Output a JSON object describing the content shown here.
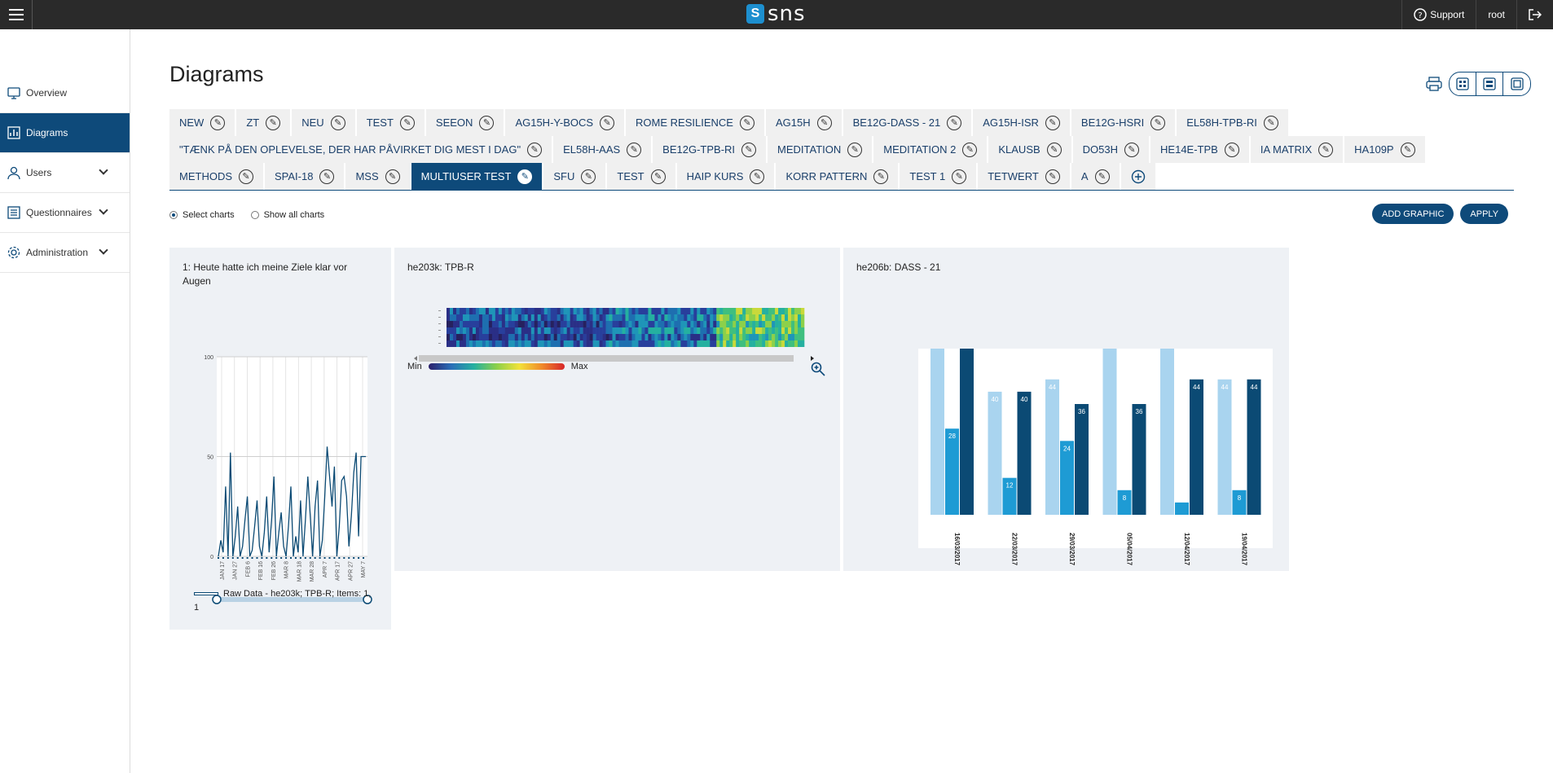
{
  "topbar": {
    "logo_text": "SNS",
    "logo_mark": "S",
    "support_label": "Support",
    "user_label": "root"
  },
  "sidebar": {
    "items": [
      {
        "label": "Overview",
        "icon": "monitor-icon",
        "active": false,
        "expandable": false
      },
      {
        "label": "Diagrams",
        "icon": "chart-icon",
        "active": true,
        "expandable": false
      },
      {
        "label": "Users",
        "icon": "user-icon",
        "active": false,
        "expandable": true
      },
      {
        "label": "Questionnaires",
        "icon": "list-icon",
        "active": false,
        "expandable": true
      },
      {
        "label": "Administration",
        "icon": "gear-icon",
        "active": false,
        "expandable": true
      }
    ]
  },
  "page": {
    "title": "Diagrams"
  },
  "tabs": {
    "row1": [
      "NEW",
      "ZT",
      "NEU",
      "TEST",
      "SEEON",
      "AG15H-Y-BOCS",
      "ROME RESILIENCE",
      "AG15H",
      "BE12G-DASS - 21",
      "AG15H-ISR",
      "BE12G-HSRI",
      "EL58H-TPB-RI"
    ],
    "row2": [
      "\"TÆNK PÅ DEN OPLEVELSE, DER HAR PÅVIRKET DIG MEST I DAG\"",
      "EL58H-AAS",
      "BE12G-TPB-RI",
      "MEDITATION",
      "MEDITATION 2",
      "KLAUSB",
      "DO53H",
      "HE14E-TPB",
      "IA MATRIX",
      "HA109P"
    ],
    "row3": [
      "METHODS",
      "SPAI-18",
      "MSS",
      "MULTIUSER TEST",
      "SFU",
      "TEST",
      "HAIP KURS",
      "KORR PATTERN",
      "TEST 1",
      "TETWERT",
      "A"
    ],
    "active": "MULTIUSER TEST"
  },
  "controls": {
    "select_charts": "Select charts",
    "show_all": "Show all charts",
    "selected": "Select charts",
    "add_graphic": "ADD GRAPHIC",
    "apply": "APPLY"
  },
  "colors": {
    "primary": "#0e4a7a",
    "accent": "#1d8fcf",
    "bar_light": "#a9d4ef",
    "bar_mid": "#1e9bd4",
    "bar_dark": "#0b4a74"
  },
  "chart1": {
    "title": "1: Heute hatte ich meine Ziele klar vor Augen",
    "legend": "Raw Data - he203k; TPB-R; Items: 1, 1"
  },
  "chart2": {
    "title": "he203k: TPB-R",
    "min_label": "Min",
    "max_label": "Max"
  },
  "chart3": {
    "title": "he206b: DASS - 21"
  },
  "chart_data": [
    {
      "type": "line",
      "title": "1: Heute hatte ich meine Ziele klar vor Augen",
      "ylim": [
        0,
        100
      ],
      "yticks": [
        "0",
        "50",
        "100"
      ],
      "xticks": [
        "JAN 17",
        "JAN 27",
        "FEB 6",
        "FEB 16",
        "FEB 26",
        "MAR 8",
        "MAR 18",
        "MAR 28",
        "APR 7",
        "APR 17",
        "APR 27",
        "MAY 7"
      ],
      "series": [
        {
          "name": "Raw Data - he203k; TPB-R; Items: 1, 1",
          "values": [
            0,
            8,
            2,
            35,
            0,
            52,
            0,
            10,
            25,
            0,
            5,
            18,
            30,
            0,
            3,
            15,
            28,
            5,
            0,
            12,
            30,
            2,
            18,
            40,
            0,
            12,
            22,
            5,
            0,
            15,
            35,
            0,
            10,
            2,
            28,
            0,
            18,
            40,
            20,
            0,
            25,
            38,
            0,
            8,
            30,
            55,
            40,
            25,
            45,
            0,
            15,
            38,
            40,
            30,
            5,
            20,
            42,
            52,
            10,
            50,
            50,
            50
          ]
        }
      ]
    },
    {
      "type": "heatmap",
      "title": "he203k: TPB-R",
      "legend": [
        "Min",
        "Max"
      ]
    },
    {
      "type": "bar",
      "title": "he206b: DASS - 21",
      "categories": [
        "16/03/2017",
        "22/03/2017",
        "29/03/2017",
        "05/04/2017",
        "12/04/2017",
        "19/04/2017"
      ],
      "series": [
        {
          "values": [
            54,
            40,
            44,
            54,
            54,
            44
          ]
        },
        {
          "values": [
            28,
            12,
            24,
            8,
            4,
            8
          ]
        },
        {
          "values": [
            54,
            40,
            36,
            36,
            44,
            44
          ]
        }
      ],
      "value_labels": [
        [
          "",
          "28",
          ""
        ],
        [
          "40",
          "12",
          "40"
        ],
        [
          "44",
          "24",
          "36"
        ],
        [
          "",
          "8",
          "36"
        ],
        [
          "",
          "",
          "44"
        ],
        [
          "44",
          "8",
          "44"
        ]
      ]
    }
  ]
}
